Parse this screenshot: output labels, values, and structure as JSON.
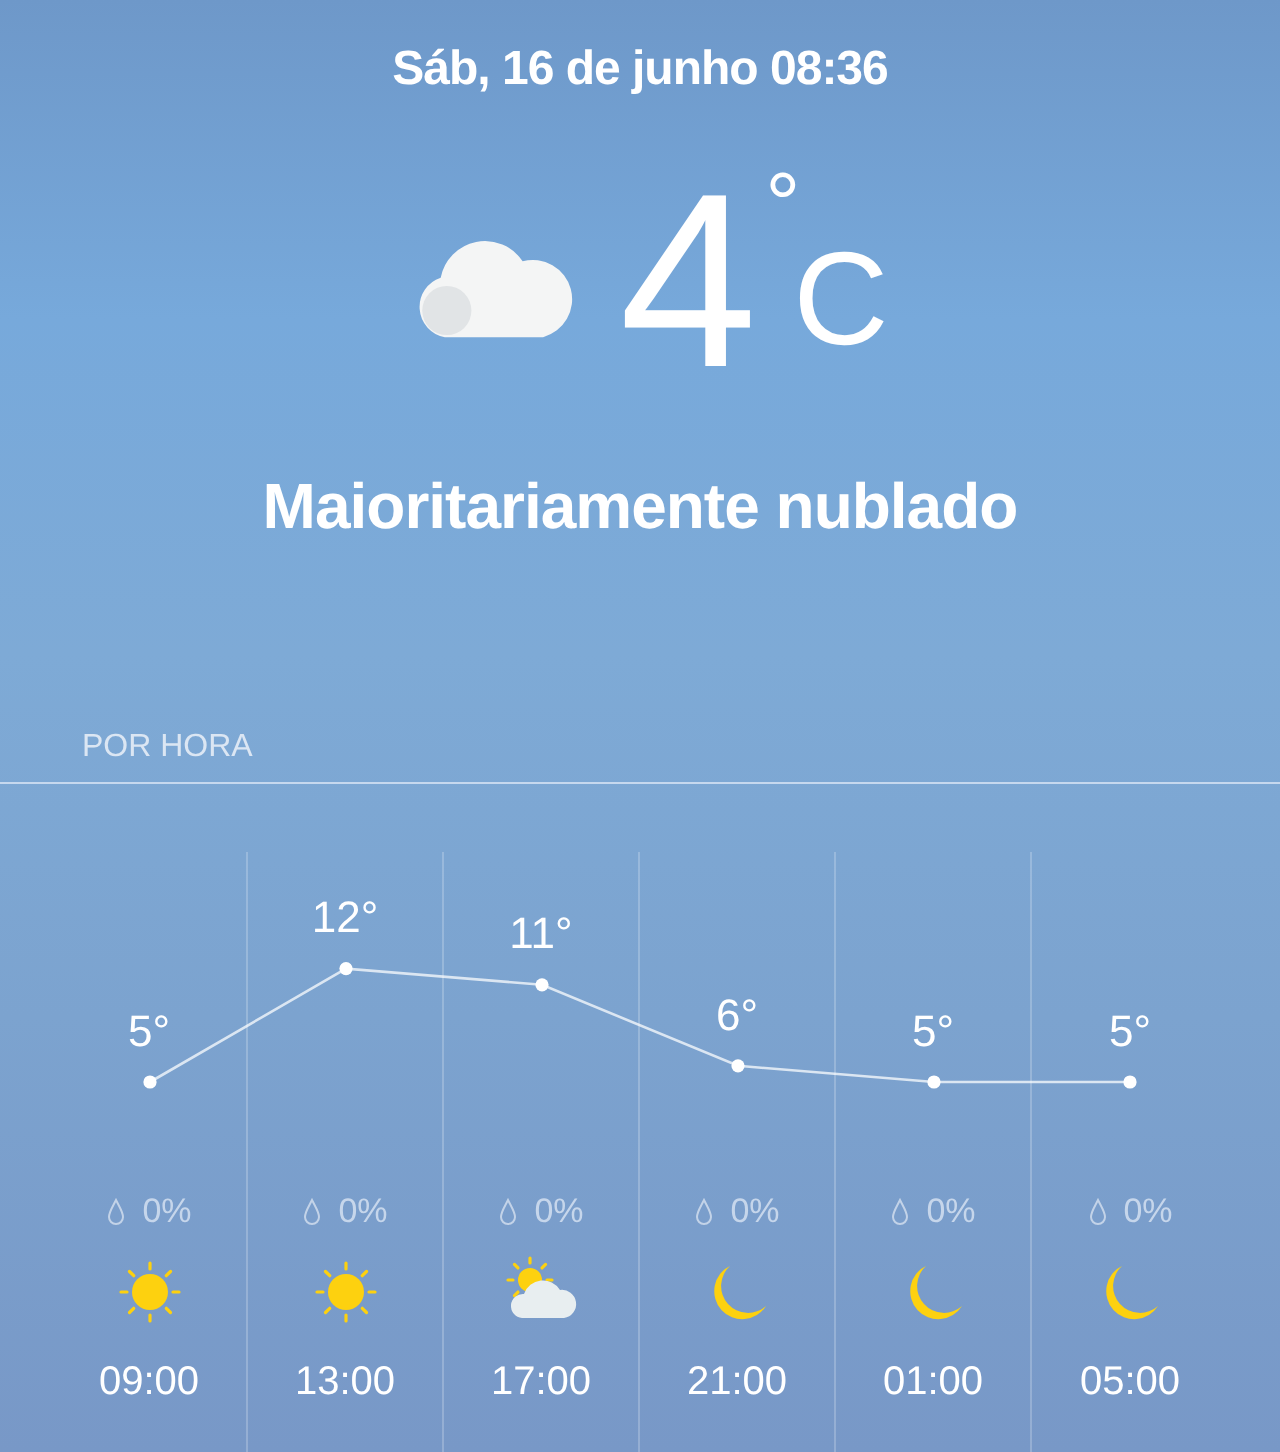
{
  "date_time": "Sáb, 16 de junho 08:36",
  "current": {
    "kind": "cloud",
    "temperature": "4",
    "unit": "°",
    "unit_letter": "C",
    "condition": "Maioritariamente nublado"
  },
  "hourly": {
    "label": "POR HORA",
    "chart_data": {
      "type": "line",
      "marker": true,
      "categories": [
        "09:00",
        "13:00",
        "17:00",
        "21:00",
        "01:00",
        "05:00"
      ],
      "values": [
        5,
        12,
        11,
        6,
        5,
        5
      ],
      "value_labels": [
        "5°",
        "12°",
        "11°",
        "6°",
        "5°",
        "5°"
      ]
    },
    "hours": [
      {
        "precipitation": "0%",
        "kind": "sun"
      },
      {
        "precipitation": "0%",
        "kind": "sun"
      },
      {
        "precipitation": "0%",
        "kind": "sun-cloud"
      },
      {
        "precipitation": "0%",
        "kind": "moon"
      },
      {
        "precipitation": "0%",
        "kind": "moon"
      },
      {
        "precipitation": "0%",
        "kind": "moon"
      }
    ]
  }
}
